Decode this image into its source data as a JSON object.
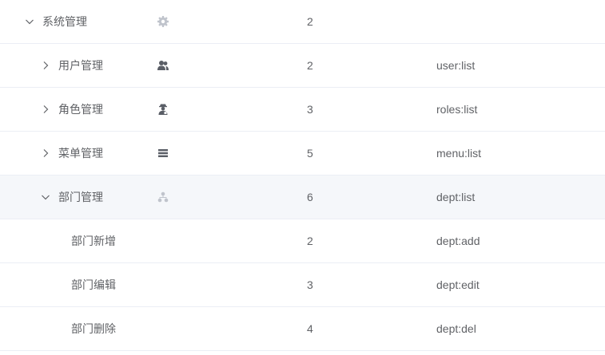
{
  "colors": {
    "text": "#606266",
    "border": "#ebeef5",
    "hover_bg": "#f5f7fa",
    "icon_dark": "#5a5e66",
    "icon_light": "#c0c4cc"
  },
  "rows": [
    {
      "name": "系统管理",
      "icon": "gear-icon",
      "sort": "2",
      "perm": ""
    },
    {
      "name": "用户管理",
      "icon": "users-icon",
      "sort": "2",
      "perm": "user:list"
    },
    {
      "name": "角色管理",
      "icon": "role-icon",
      "sort": "3",
      "perm": "roles:list"
    },
    {
      "name": "菜单管理",
      "icon": "menu-icon",
      "sort": "5",
      "perm": "menu:list"
    },
    {
      "name": "部门管理",
      "icon": "dept-icon",
      "sort": "6",
      "perm": "dept:list"
    },
    {
      "name": "部门新增",
      "icon": "",
      "sort": "2",
      "perm": "dept:add"
    },
    {
      "name": "部门编辑",
      "icon": "",
      "sort": "3",
      "perm": "dept:edit"
    },
    {
      "name": "部门删除",
      "icon": "",
      "sort": "4",
      "perm": "dept:del"
    }
  ]
}
